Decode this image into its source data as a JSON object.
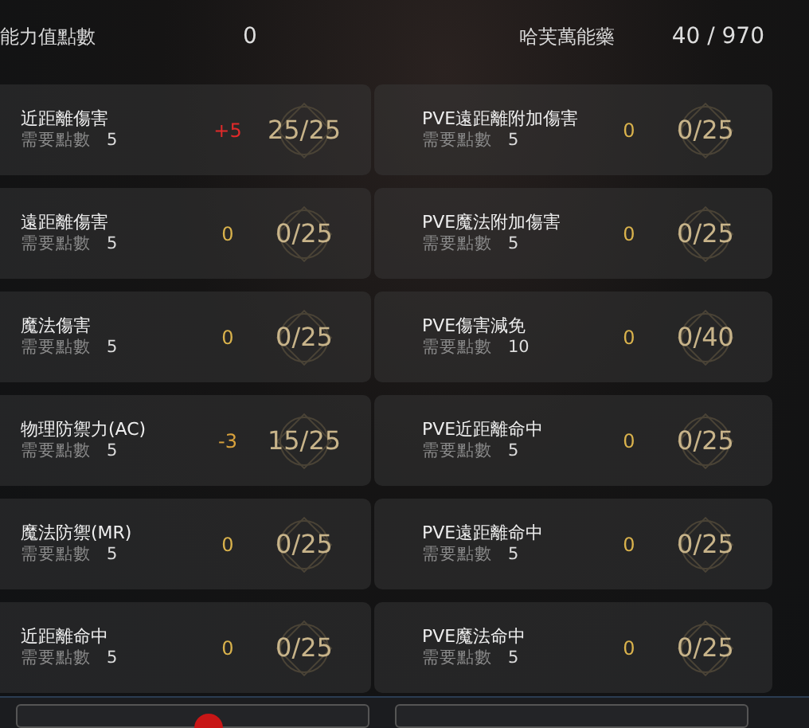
{
  "header": {
    "points_label": "能力值點數",
    "points_value": "0",
    "item_label": "哈芙萬能藥",
    "item_value": "40 / 970"
  },
  "columns": [
    {
      "stats": [
        {
          "name": "近距離傷害",
          "cost_label": "需要點數",
          "cost": "5",
          "change": "+5",
          "color": "#e02a2a",
          "progress": "25/25"
        },
        {
          "name": "遠距離傷害",
          "cost_label": "需要點數",
          "cost": "5",
          "change": "0",
          "color": "#d9b24c",
          "progress": "0/25"
        },
        {
          "name": "魔法傷害",
          "cost_label": "需要點數",
          "cost": "5",
          "change": "0",
          "color": "#d9b24c",
          "progress": "0/25"
        },
        {
          "name": "物理防禦力(AC)",
          "cost_label": "需要點數",
          "cost": "5",
          "change": "-3",
          "color": "#d9a23c",
          "progress": "15/25"
        },
        {
          "name": "魔法防禦(MR)",
          "cost_label": "需要點數",
          "cost": "5",
          "change": "0",
          "color": "#d9b24c",
          "progress": "0/25"
        },
        {
          "name": "近距離命中",
          "cost_label": "需要點數",
          "cost": "5",
          "change": "0",
          "color": "#d9b24c",
          "progress": "0/25"
        }
      ]
    },
    {
      "stats": [
        {
          "name": "PVE遠距離附加傷害",
          "cost_label": "需要點數",
          "cost": "5",
          "change": "0",
          "color": "#d9b24c",
          "progress": "0/25"
        },
        {
          "name": "PVE魔法附加傷害",
          "cost_label": "需要點數",
          "cost": "5",
          "change": "0",
          "color": "#d9b24c",
          "progress": "0/25"
        },
        {
          "name": "PVE傷害減免",
          "cost_label": "需要點數",
          "cost": "10",
          "change": "0",
          "color": "#d9b24c",
          "progress": "0/40"
        },
        {
          "name": "PVE近距離命中",
          "cost_label": "需要點數",
          "cost": "5",
          "change": "0",
          "color": "#d9b24c",
          "progress": "0/25"
        },
        {
          "name": "PVE遠距離命中",
          "cost_label": "需要點數",
          "cost": "5",
          "change": "0",
          "color": "#d9b24c",
          "progress": "0/25"
        },
        {
          "name": "PVE魔法命中",
          "cost_label": "需要點數",
          "cost": "5",
          "change": "0",
          "color": "#d9b24c",
          "progress": "0/25"
        }
      ]
    }
  ]
}
